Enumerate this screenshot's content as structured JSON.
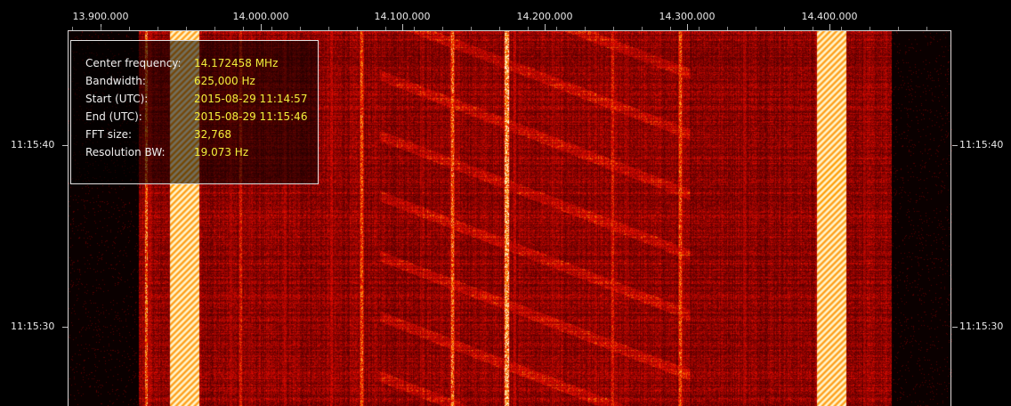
{
  "frequency_axis": {
    "labels": [
      "13.900.000",
      "14.000.000",
      "14.100.000",
      "14.200.000",
      "14.300.000",
      "14.400.000"
    ]
  },
  "time_axis": {
    "labels": [
      "11:15:40",
      "11:15:30"
    ]
  },
  "info": {
    "rows": [
      {
        "key": "Center frequency:",
        "value": "14.172458 MHz"
      },
      {
        "key": "Bandwidth:",
        "value": "625,000 Hz"
      },
      {
        "key": "Start (UTC):",
        "value": "2015-08-29 11:14:57"
      },
      {
        "key": "End (UTC):",
        "value": "2015-08-29 11:15:46"
      },
      {
        "key": "FFT size:",
        "value": "32,768"
      },
      {
        "key": "Resolution BW:",
        "value": "19.073 Hz"
      }
    ]
  },
  "colors": {
    "background": "#000000",
    "axis_text": "#e8e8e8",
    "info_value": "#f4ef3a",
    "signal_low": "#3a0000",
    "signal_mid": "#c01800",
    "signal_high": "#ffe060",
    "signal_peak": "#ffffd0"
  }
}
